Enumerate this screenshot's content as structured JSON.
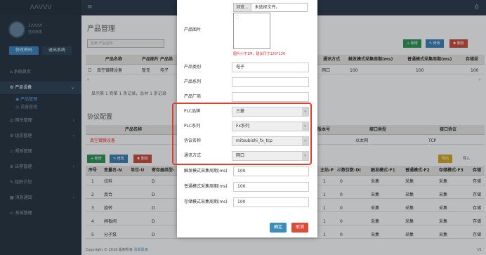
{
  "topbar": {
    "logo": "ΛΛVVV"
  },
  "sidebar": {
    "username": "1ΛΛΛΛ",
    "user_status": "在线状态",
    "edit_btn": "修改密码",
    "logout_btn": "退出系统",
    "items": [
      {
        "label": "系统首页"
      },
      {
        "label": "产品设备",
        "active": true
      },
      {
        "label": "产品管理",
        "sub": true,
        "current": true
      },
      {
        "label": "设备管理",
        "sub": true
      },
      {
        "label": "网关管理"
      },
      {
        "label": "组态管理"
      },
      {
        "label": "规则管理"
      },
      {
        "label": "告警管理"
      },
      {
        "label": "组织计划"
      },
      {
        "label": "消息通知"
      },
      {
        "label": "系统管理"
      }
    ]
  },
  "page": {
    "title": "产品管理",
    "search_placeholder": "检索 产品名称",
    "buttons": {
      "add": "+ 新增",
      "edit": "✎ 修改",
      "delete": "✖ 删除"
    },
    "table": {
      "headers": [
        "产品名称",
        "产品图片",
        "产品类",
        "通讯方式",
        "触发模式采集周期(ms)",
        "普通模式采集周期(ms)",
        "存储采"
      ],
      "row": [
        "真空镀膜设备",
        "暂无",
        "电子",
        "网口",
        "100",
        "100",
        "100"
      ],
      "footer": "显示第 1 到第 1 条记录，总共 1 条记录"
    },
    "protocol": {
      "title": "协议配置",
      "headers": [
        "产品名称",
        "版本号",
        "接口类型",
        "接口协议"
      ],
      "row": [
        "真空镀膜设备",
        "",
        "以太网",
        "TCP"
      ],
      "buttons": {
        "add": "+ 新增",
        "edit": "✎ 修改",
        "delete": "✖ 删除",
        "export": "导出",
        "import": "导入"
      },
      "col_headers": [
        "序号",
        "变量名-N",
        "单位-U",
        "寄存器类型-",
        "主站-P",
        "小数位数-DI",
        "触发模式-F1",
        "普通模式-F2",
        "存储模式-F3",
        "存储"
      ],
      "rows": [
        [
          "1",
          "拉料",
          "D",
          "1",
          "0",
          "采集",
          "采集",
          "采集",
          "存储"
        ],
        [
          "2",
          "真合",
          "D",
          "1",
          "0",
          "采集",
          "采集",
          "采集",
          "存储"
        ],
        [
          "3",
          "旋转",
          "D",
          "1",
          "0",
          "采集",
          "采集",
          "采集",
          "存储"
        ],
        [
          "4",
          "闸板阀",
          "D",
          "1",
          "0",
          "采集",
          "采集",
          "采集",
          "存储"
        ],
        [
          "5",
          "分子泵",
          "D",
          "1",
          "0",
          "采集",
          "采集",
          "采集",
          "存储"
        ]
      ]
    },
    "copyright": "Copyright © 2019 版权所有",
    "copyright_link": "张翠翠滴",
    "version": "V1"
  },
  "modal": {
    "browse_btn": "浏览...",
    "file_status": "未选择文件。",
    "image_label": "产品图片",
    "image_hint": "图片小于1M，建议尺寸120*120",
    "fields": [
      {
        "label": "产品类别",
        "value": "电子"
      },
      {
        "label": "产品系列",
        "value": ""
      },
      {
        "label": "产品厂商",
        "value": ""
      }
    ],
    "selects": [
      {
        "label": "PLC品牌",
        "value": "三菱"
      },
      {
        "label": "PLC系列",
        "value": "Fx系列"
      },
      {
        "label": "协议名称",
        "value": "mitsubishi_fx_tcp"
      },
      {
        "label": "通讯方式",
        "value": "网口"
      }
    ],
    "periods": [
      {
        "label": "触发模式采集周期(ms)",
        "value": "100"
      },
      {
        "label": "普通模式采集周期(ms)",
        "value": "100"
      },
      {
        "label": "存储模式采集周期(ms)",
        "value": "100"
      }
    ],
    "confirm": "确定",
    "cancel": "取消"
  },
  "colors": {
    "highlight": "#e23d2d",
    "primary": "#3c8dbc",
    "danger": "#dd4b39",
    "success": "#00a65a"
  }
}
